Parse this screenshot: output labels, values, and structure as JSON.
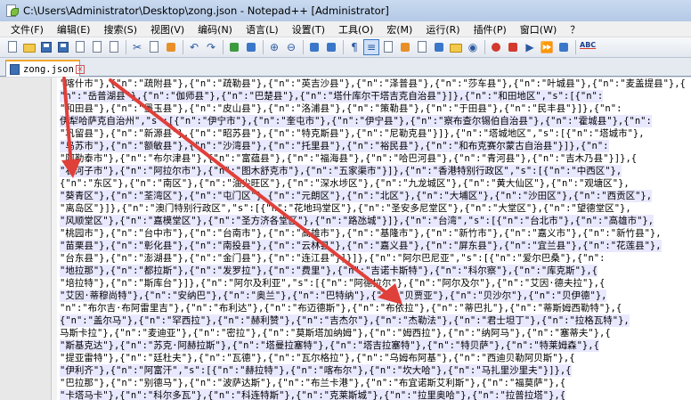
{
  "window": {
    "title": "C:\\Users\\Administrator\\Desktop\\zong.json - Notepad++ [Administrator]"
  },
  "menu": [
    "文件(F)",
    "编辑(E)",
    "搜索(S)",
    "视图(V)",
    "编码(N)",
    "语言(L)",
    "设置(T)",
    "工具(O)",
    "宏(M)",
    "运行(R)",
    "插件(P)",
    "窗口(W)",
    "？"
  ],
  "toolbar": {
    "icons": [
      "new-file-icon",
      "open-file-icon",
      "save-icon",
      "save-all-icon",
      "close-icon",
      "close-all-icon",
      "print-icon",
      "cut-icon",
      "copy-icon",
      "paste-icon",
      "undo-icon",
      "redo-icon",
      "find-icon",
      "replace-icon",
      "zoom-in-icon",
      "zoom-out-icon",
      "sync-v-icon",
      "sync-h-icon",
      "word-wrap-icon",
      "show-all-icon",
      "indent-guide-icon",
      "udl-icon",
      "doc-map-icon",
      "function-list-icon",
      "folder-workspace-icon",
      "monitor-icon",
      "record-icon",
      "stop-icon",
      "play-icon",
      "run-multiple-icon",
      "save-macro-icon",
      "spellcheck-icon"
    ],
    "spellcheck_label": "ABC"
  },
  "tab": {
    "label": "zong.json"
  },
  "editor": {
    "lines": [
      "\"喀什市\"},{\"n\":\"疏附县\"},{\"n\":\"疏勒县\"},{\"n\":\"英吉沙县\"},{\"n\":\"泽普县\"},{\"n\":\"莎车县\"},{\"n\":\"叶城县\"},{\"n\":\"麦盖提县\"},{",
      "\"n\":\"岳普湖县\"},{\"n\":\"伽师县\"},{\"n\":\"巴楚县\"},{\"n\":\"塔什库尔干塔吉克自治县\"}]},{\"n\":\"和田地区\",\"s\":[{\"n\":",
      "\"和田县\"},{\"n\":\"墨玉县\"},{\"n\":\"皮山县\"},{\"n\":\"洛浦县\"},{\"n\":\"策勒县\"},{\"n\":\"于田县\"},{\"n\":\"民丰县\"}]},{\"n\":",
      "伊犁哈萨克自治州\",\"s\":[{\"n\":\"伊宁市\"},{\"n\":\"奎屯市\"},{\"n\":\"伊宁县\"},{\"n\":\"察布查尔锡伯自治县\"},{\"n\":\"霍城县\"},{\"n\":",
      "\"巩留县\"},{\"n\":\"新源县\"},{\"n\":\"昭苏县\"},{\"n\":\"特克斯县\"},{\"n\":\"尼勒克县\"}]},{\"n\":\"塔城地区\",\"s\":[{\"n\":\"塔城市\"},",
      "\"乌苏市\"},{\"n\":\"额敏县\"},{\"n\":\"沙湾县\"},{\"n\":\"托里县\"},{\"n\":\"裕民县\"},{\"n\":\"和布克赛尔蒙古自治县\"}]},{\"n\":",
      "\"阿勒泰市\"},{\"n\":\"布尔津县\"},{\"n\":\"富蕴县\"},{\"n\":\"福海县\"},{\"n\":\"哈巴河县\"},{\"n\":\"青河县\"},{\"n\":\"吉木乃县\"}]},{",
      "\"石河子市\"},{\"n\":\"阿拉尔市\"},{\"n\":\"图木舒克市\"},{\"n\":\"五家渠市\"}]},{\"n\":\"香港特别行政区\",\"s\":[{\"n\":\"中西区\"},",
      "{\"n\":\"东区\"},{\"n\":\"南区\"},{\"n\":\"油尖旺区\"},{\"n\":\"深水埗区\"},{\"n\":\"九龙城区\"},{\"n\":\"黄大仙区\"},{\"n\":\"观塘区\"},",
      "\"葵青区\"},{\"n\":\"荃湾区\"},{\"n\":\"屯门区\"},{\"n\":\"元朗区\"},{\"n\":\"北区\"},{\"n\":\"大埔区\"},{\"n\":\"沙田区\"},{\"n\":\"西贡区\"},",
      "\"离岛区\"}]},{\"n\":\"澳门特别行政区\",\"s\":[{\"n\":\"花地玛堂区\"},{\"n\":\"圣安多尼堂区\"},{\"n\":\"大堂区\"},{\"n\":\"望德堂区\"},",
      "\"风顺堂区\"},{\"n\":\"嘉模堂区\"},{\"n\":\"圣方济各堂区\"},{\"n\":\"路氹城\"}]},{\"n\":\"台湾\",\"s\":[{\"n\":\"台北市\"},{\"n\":\"高雄市\"},",
      "\"桃园市\"},{\"n\":\"台中市\"},{\"n\":\"台南市\"},{\"n\":\"高雄市\"},{\"n\":\"基隆市\"},{\"n\":\"新竹市\"},{\"n\":\"嘉义市\"},{\"n\":\"新竹县\"},",
      "\"苗栗县\"},{\"n\":\"彰化县\"},{\"n\":\"南投县\"},{\"n\":\"云林县\"},{\"n\":\"嘉义县\"},{\"n\":\"屏东县\"},{\"n\":\"宜兰县\"},{\"n\":\"花莲县\"},",
      "\"台东县\"},{\"n\":\"澎湖县\"},{\"n\":\"金门县\"},{\"n\":\"连江县\"}]}]},{\"n\":\"阿尔巴尼亚\",\"s\":[{\"n\":\"爱尔巴桑\"},{\"n\":",
      "\"地拉那\"},{\"n\":\"都拉斯\"},{\"n\":\"发罗拉\"},{\"n\":\"费里\"},{\"n\":\"吉诺卡斯特\"},{\"n\":\"科尔察\"},{\"n\":\"库克斯\"},{",
      "\"培拉特\"},{\"n\":\"斯库台\"}]},{\"n\":\"阿尔及利亚\",\"s\":[{\"n\":\"阿德拉尔\"},{\"n\":\"阿尔及尔\"},{\"n\":\"艾因·德夫拉\"},{",
      "\"艾因·蒂穆尚特\"},{\"n\":\"安纳巴\"},{\"n\":\"奥兰\"},{\"n\":\"巴特纳\"},{\"n\":\"贝贾亚\"},{\"n\":\"贝沙尔\"},{\"n\":\"贝伊德\"},",
      "\"n\":\"布尔吉·布阿雷里吉\"},{\"n\":\"布利达\"},{\"n\":\"布迈德斯\"},{\"n\":\"布依拉\"},{\"n\":\"蒂巴扎\"},{\"n\":\"蒂斯姆西勒特\"},{",
      "{\"n\":\"盖尔马\"},{\"n\":\"罕西拉\"},{\"n\":\"赫利赞\"},{\"n\":\"吉杰尔\"},{\"n\":\"杰勒法\"},{\"n\":\"君士坦丁\"},{\"n\":\"拉格瓦特\"},",
      "马斯卡拉\"},{\"n\":\"麦迪亚\"},{\"n\":\"密拉\"},{\"n\":\"莫斯塔加纳姆\"},{\"n\":\"姆西拉\"},{\"n\":\"纳阿马\"},{\"n\":\"塞蒂夫\"},{",
      "\"斯基克达\"},{\"n\":\"苏克·阿赫拉斯\"},{\"n\":\"塔曼拉塞特\"},{\"n\":\"塔吉拉塞特\"},{\"n\":\"特贝萨\"},{\"n\":\"特莱姆森\"},{",
      "\"提亚雷特\"},{\"n\":\"廷杜夫\"},{\"n\":\"瓦德\"},{\"n\":\"瓦尔格拉\"},{\"n\":\"乌姆布阿基\"},{\"n\":\"西迪贝勒阿贝斯\"},{",
      "\"伊利齐\"},{\"n\":\"阿富汗\",\"s\":[{\"n\":\"赫拉特\"},{\"n\":\"喀布尔\"},{\"n\":\"坎大哈\"},{\"n\":\"马扎里沙里夫\"}]},{",
      "\"巴拉那\"},{\"n\":\"别德马\"},{\"n\":\"波萨达斯\"},{\"n\":\"布兰卡港\"},{\"n\":\"布宜诺斯艾利斯\"},{\"n\":\"福莫萨\"},{",
      "\"卡塔马卡\"},{\"n\":\"科尔多瓦\"},{\"n\":\"科连特斯\"},{\"n\":\"克莱斯城\"},{\"n\":\"拉里奥哈\"},{\"n\":\"拉普拉塔\"},{"
    ]
  },
  "colors": {
    "arrow": "#e0403a",
    "highlight": "#e8e8ff"
  }
}
